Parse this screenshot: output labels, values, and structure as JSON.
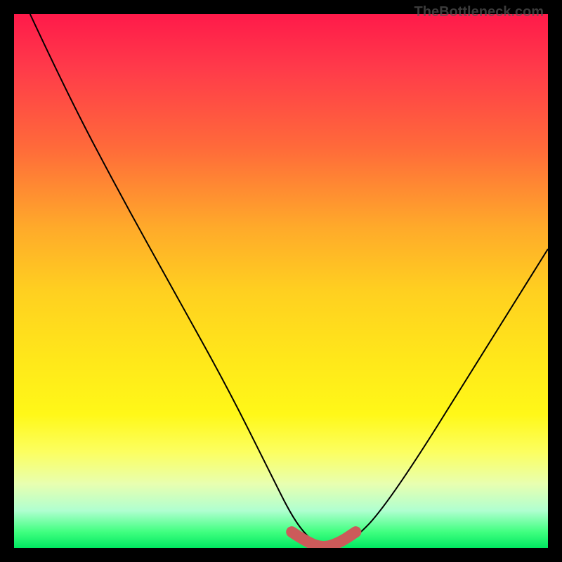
{
  "watermark": "TheBottleneck.com",
  "chart_data": {
    "type": "line",
    "title": "",
    "xlabel": "",
    "ylabel": "",
    "xlim": [
      0,
      100
    ],
    "ylim": [
      0,
      100
    ],
    "series": [
      {
        "name": "bottleneck-curve",
        "x": [
          3,
          10,
          20,
          30,
          40,
          48,
          52,
          55,
          58,
          61,
          64,
          68,
          75,
          85,
          95,
          100
        ],
        "y": [
          100,
          85,
          66,
          48,
          30,
          14,
          6,
          2,
          0,
          0,
          2,
          6,
          16,
          32,
          48,
          56
        ]
      },
      {
        "name": "highlight-region",
        "x": [
          52,
          55,
          58,
          61,
          64
        ],
        "y": [
          3,
          1,
          0,
          1,
          3
        ]
      }
    ],
    "annotations": []
  }
}
